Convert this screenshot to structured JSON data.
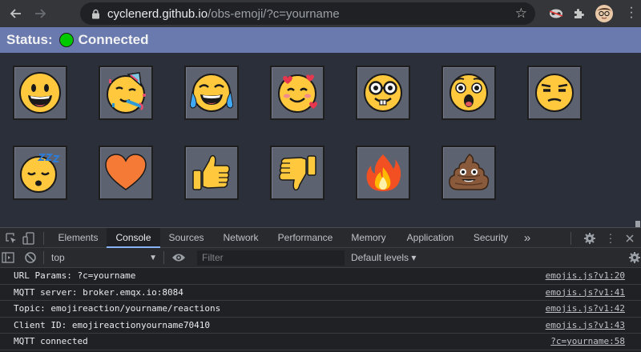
{
  "browser": {
    "url_host": "cyclenerd.github.io",
    "url_path": "/obs-emoji/?c=yourname"
  },
  "page": {
    "status_label": "Status:",
    "status_value": "Connected",
    "status_color": "#00c900",
    "emoji_buttons": [
      {
        "name": "grinning-face"
      },
      {
        "name": "partying-face"
      },
      {
        "name": "tears-of-joy-face"
      },
      {
        "name": "smiling-face-with-hearts"
      },
      {
        "name": "nerd-face"
      },
      {
        "name": "astonished-face"
      },
      {
        "name": "unamused-face"
      },
      {
        "name": "sleeping-face"
      },
      {
        "name": "orange-heart"
      },
      {
        "name": "thumbs-up"
      },
      {
        "name": "thumbs-down"
      },
      {
        "name": "fire"
      },
      {
        "name": "pile-of-poo"
      }
    ]
  },
  "devtools": {
    "tabs": [
      "Elements",
      "Console",
      "Sources",
      "Network",
      "Performance",
      "Memory",
      "Application",
      "Security"
    ],
    "active_tab": "Console",
    "more_tabs": "»",
    "context": "top",
    "filter_placeholder": "Filter",
    "levels": "Default levels ▾",
    "console_messages": [
      {
        "text": "URL Params: ?c=yourname",
        "source": "emojis.js?v1:20"
      },
      {
        "text": "MQTT server: broker.emqx.io:8084",
        "source": "emojis.js?v1:41"
      },
      {
        "text": "Topic: emojireaction/yourname/reactions",
        "source": "emojis.js?v1:42"
      },
      {
        "text": "Client ID: emojireactionyourname70410",
        "source": "emojis.js?v1:43"
      },
      {
        "text": "MQTT connected",
        "source": "?c=yourname:58"
      }
    ]
  }
}
